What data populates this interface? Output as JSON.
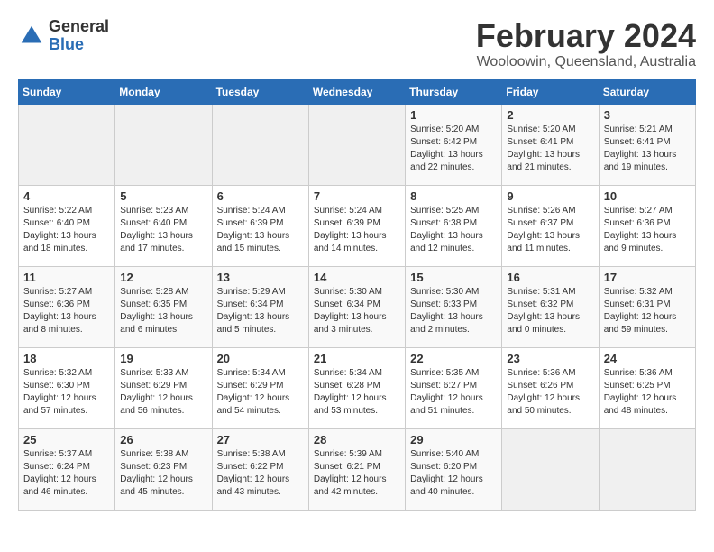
{
  "header": {
    "logo_general": "General",
    "logo_blue": "Blue",
    "month_title": "February 2024",
    "location": "Wooloowin, Queensland, Australia"
  },
  "days_of_week": [
    "Sunday",
    "Monday",
    "Tuesday",
    "Wednesday",
    "Thursday",
    "Friday",
    "Saturday"
  ],
  "weeks": [
    [
      {
        "day": "",
        "info": ""
      },
      {
        "day": "",
        "info": ""
      },
      {
        "day": "",
        "info": ""
      },
      {
        "day": "",
        "info": ""
      },
      {
        "day": "1",
        "info": "Sunrise: 5:20 AM\nSunset: 6:42 PM\nDaylight: 13 hours\nand 22 minutes."
      },
      {
        "day": "2",
        "info": "Sunrise: 5:20 AM\nSunset: 6:41 PM\nDaylight: 13 hours\nand 21 minutes."
      },
      {
        "day": "3",
        "info": "Sunrise: 5:21 AM\nSunset: 6:41 PM\nDaylight: 13 hours\nand 19 minutes."
      }
    ],
    [
      {
        "day": "4",
        "info": "Sunrise: 5:22 AM\nSunset: 6:40 PM\nDaylight: 13 hours\nand 18 minutes."
      },
      {
        "day": "5",
        "info": "Sunrise: 5:23 AM\nSunset: 6:40 PM\nDaylight: 13 hours\nand 17 minutes."
      },
      {
        "day": "6",
        "info": "Sunrise: 5:24 AM\nSunset: 6:39 PM\nDaylight: 13 hours\nand 15 minutes."
      },
      {
        "day": "7",
        "info": "Sunrise: 5:24 AM\nSunset: 6:39 PM\nDaylight: 13 hours\nand 14 minutes."
      },
      {
        "day": "8",
        "info": "Sunrise: 5:25 AM\nSunset: 6:38 PM\nDaylight: 13 hours\nand 12 minutes."
      },
      {
        "day": "9",
        "info": "Sunrise: 5:26 AM\nSunset: 6:37 PM\nDaylight: 13 hours\nand 11 minutes."
      },
      {
        "day": "10",
        "info": "Sunrise: 5:27 AM\nSunset: 6:36 PM\nDaylight: 13 hours\nand 9 minutes."
      }
    ],
    [
      {
        "day": "11",
        "info": "Sunrise: 5:27 AM\nSunset: 6:36 PM\nDaylight: 13 hours\nand 8 minutes."
      },
      {
        "day": "12",
        "info": "Sunrise: 5:28 AM\nSunset: 6:35 PM\nDaylight: 13 hours\nand 6 minutes."
      },
      {
        "day": "13",
        "info": "Sunrise: 5:29 AM\nSunset: 6:34 PM\nDaylight: 13 hours\nand 5 minutes."
      },
      {
        "day": "14",
        "info": "Sunrise: 5:30 AM\nSunset: 6:34 PM\nDaylight: 13 hours\nand 3 minutes."
      },
      {
        "day": "15",
        "info": "Sunrise: 5:30 AM\nSunset: 6:33 PM\nDaylight: 13 hours\nand 2 minutes."
      },
      {
        "day": "16",
        "info": "Sunrise: 5:31 AM\nSunset: 6:32 PM\nDaylight: 13 hours\nand 0 minutes."
      },
      {
        "day": "17",
        "info": "Sunrise: 5:32 AM\nSunset: 6:31 PM\nDaylight: 12 hours\nand 59 minutes."
      }
    ],
    [
      {
        "day": "18",
        "info": "Sunrise: 5:32 AM\nSunset: 6:30 PM\nDaylight: 12 hours\nand 57 minutes."
      },
      {
        "day": "19",
        "info": "Sunrise: 5:33 AM\nSunset: 6:29 PM\nDaylight: 12 hours\nand 56 minutes."
      },
      {
        "day": "20",
        "info": "Sunrise: 5:34 AM\nSunset: 6:29 PM\nDaylight: 12 hours\nand 54 minutes."
      },
      {
        "day": "21",
        "info": "Sunrise: 5:34 AM\nSunset: 6:28 PM\nDaylight: 12 hours\nand 53 minutes."
      },
      {
        "day": "22",
        "info": "Sunrise: 5:35 AM\nSunset: 6:27 PM\nDaylight: 12 hours\nand 51 minutes."
      },
      {
        "day": "23",
        "info": "Sunrise: 5:36 AM\nSunset: 6:26 PM\nDaylight: 12 hours\nand 50 minutes."
      },
      {
        "day": "24",
        "info": "Sunrise: 5:36 AM\nSunset: 6:25 PM\nDaylight: 12 hours\nand 48 minutes."
      }
    ],
    [
      {
        "day": "25",
        "info": "Sunrise: 5:37 AM\nSunset: 6:24 PM\nDaylight: 12 hours\nand 46 minutes."
      },
      {
        "day": "26",
        "info": "Sunrise: 5:38 AM\nSunset: 6:23 PM\nDaylight: 12 hours\nand 45 minutes."
      },
      {
        "day": "27",
        "info": "Sunrise: 5:38 AM\nSunset: 6:22 PM\nDaylight: 12 hours\nand 43 minutes."
      },
      {
        "day": "28",
        "info": "Sunrise: 5:39 AM\nSunset: 6:21 PM\nDaylight: 12 hours\nand 42 minutes."
      },
      {
        "day": "29",
        "info": "Sunrise: 5:40 AM\nSunset: 6:20 PM\nDaylight: 12 hours\nand 40 minutes."
      },
      {
        "day": "",
        "info": ""
      },
      {
        "day": "",
        "info": ""
      }
    ]
  ]
}
